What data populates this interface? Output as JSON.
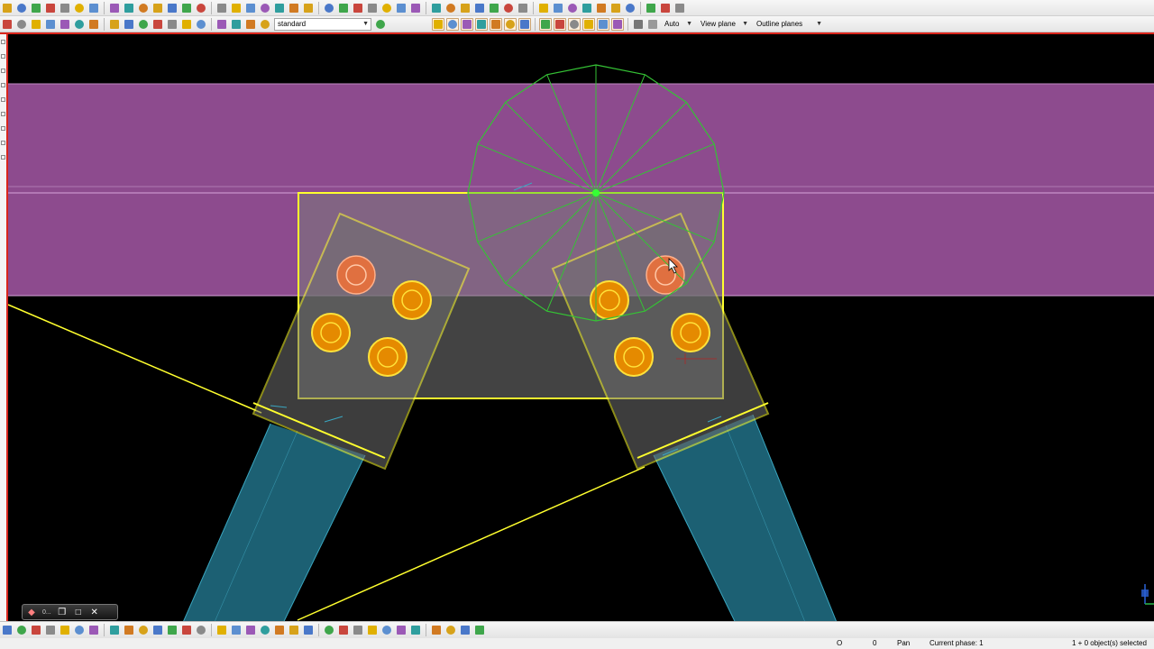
{
  "toolbar": {
    "row1_icons": [
      "new-icon",
      "open-icon",
      "save-icon",
      "save-as-icon",
      "undo-icon",
      "redo-icon",
      "copy-icon",
      "move-icon",
      "rotate-icon",
      "mirror-icon",
      "array-icon",
      "delete-icon",
      "select-icon",
      "view-icon",
      "zoom-window-icon",
      "zoom-all-icon",
      "pan-icon",
      "zoom-icon",
      "fly-icon",
      "clip-plane-icon",
      "grid-icon",
      "work-plane-icon",
      "snap-icon",
      "measure-icon",
      "dimension-icon",
      "text-icon",
      "cut-icon",
      "weld-icon",
      "bolt-icon",
      "beam-icon",
      "column-icon",
      "plate-icon",
      "part-icon",
      "assembly-icon",
      "numbering-icon",
      "report-icon",
      "drawing-icon",
      "component-icon",
      "help-icon",
      "inquire-icon",
      "properties-icon",
      "filter-icon",
      "phase-icon",
      "lock-icon",
      "more-icon"
    ],
    "row2_icons_left": [
      "select-all-icon",
      "select-part-icon",
      "select-surface-icon",
      "select-cut-icon",
      "select-grid-icon",
      "select-weld-icon",
      "select-bolt-icon",
      "select-component-icon",
      "select-assembly-icon",
      "select-point-icon",
      "select-plane-icon",
      "select-line-icon",
      "select-reference-icon",
      "select-detail-icon",
      "select-connection-icon",
      "select-object-icon",
      "select-filter-icon",
      "select-view-icon"
    ],
    "standard_combo": "standard",
    "row2_icons_snap": [
      "snap-reference-icon",
      "snap-geometry-icon",
      "snap-center-icon",
      "snap-midpoint-icon",
      "snap-intersection-icon",
      "snap-perpendicular-icon",
      "snap-line-icon",
      "snap-nearest-icon",
      "snap-free-icon",
      "snap-override-icon",
      "snap-ortho-icon",
      "snap-plane-icon",
      "snap-depth-icon"
    ],
    "auto_label": "Auto",
    "view_plane_label": "View plane",
    "outline_planes_label": "Outline planes"
  },
  "mini_window": {
    "label": "0..."
  },
  "bottom_toolbar": {
    "icons": [
      "beam-icon",
      "column-icon",
      "plate-icon",
      "polybeam-icon",
      "contour-plate-icon",
      "pad-footing-icon",
      "strip-footing-icon",
      "slab-icon",
      "wall-icon",
      "panel-icon",
      "bolt-icon",
      "weld-icon",
      "chamfer-icon",
      "fitting-icon",
      "line-cut-icon",
      "polygon-cut-icon",
      "part-cut-icon",
      "add-to-assembly-icon",
      "remove-from-assembly-icon",
      "rebar-icon",
      "mesh-icon",
      "strand-icon",
      "surface-treatment-icon",
      "component-icon",
      "detail-icon",
      "seam-icon",
      "connection-icon",
      "create-view-icon",
      "clip-plane-icon",
      "ruler-icon",
      "check-icon",
      "arrow-icon"
    ]
  },
  "status_bar": {
    "coord_o": "O",
    "coord_zero": "0",
    "mode": "Pan",
    "phase": "Current phase: 1",
    "selection": "1 + 0 object(s) selected"
  },
  "colors": {
    "beam_fill": "#954f96",
    "plate": "#ffff2e",
    "bolt_active": "#e07040",
    "bolt": "#e58a00",
    "brace": "#1f6a80",
    "work_circle": "#35c235",
    "highlight": "#d9261c"
  }
}
